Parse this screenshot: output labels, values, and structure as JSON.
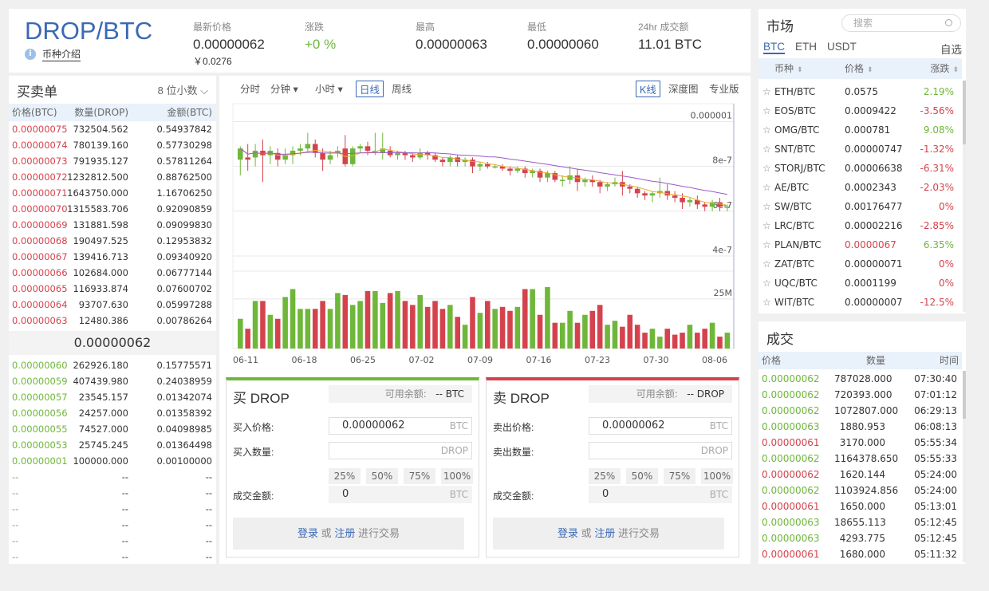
{
  "header": {
    "pair": "DROP/BTC",
    "intro": "币种介绍",
    "stats": [
      {
        "label": "最新价格",
        "value": "0.00000062",
        "sub": "￥0.0276"
      },
      {
        "label": "涨跌",
        "value": "+0 %"
      },
      {
        "label": "最高",
        "value": "0.00000063"
      },
      {
        "label": "最低",
        "value": "0.00000060"
      },
      {
        "label": "24hr 成交额",
        "value": "11.01 BTC"
      }
    ]
  },
  "orderbook": {
    "title": "买卖单",
    "precision": "8 位小数",
    "headers": [
      "价格(BTC)",
      "数量(DROP)",
      "金额(BTC)"
    ],
    "asks": [
      [
        "0.00000075",
        "732504.562",
        "0.54937842"
      ],
      [
        "0.00000074",
        "780139.160",
        "0.57730298"
      ],
      [
        "0.00000073",
        "791935.127",
        "0.57811264"
      ],
      [
        "0.00000072",
        "1232812.500",
        "0.88762500"
      ],
      [
        "0.00000071",
        "1643750.000",
        "1.16706250"
      ],
      [
        "0.00000070",
        "1315583.706",
        "0.92090859"
      ],
      [
        "0.00000069",
        "131881.598",
        "0.09099830"
      ],
      [
        "0.00000068",
        "190497.525",
        "0.12953832"
      ],
      [
        "0.00000067",
        "139416.713",
        "0.09340920"
      ],
      [
        "0.00000066",
        "102684.000",
        "0.06777144"
      ],
      [
        "0.00000065",
        "116933.874",
        "0.07600702"
      ],
      [
        "0.00000064",
        "93707.630",
        "0.05997288"
      ],
      [
        "0.00000063",
        "12480.386",
        "0.00786264"
      ]
    ],
    "last": "0.00000062",
    "bids": [
      [
        "0.00000060",
        "262926.180",
        "0.15775571"
      ],
      [
        "0.00000059",
        "407439.980",
        "0.24038959"
      ],
      [
        "0.00000057",
        "23545.157",
        "0.01342074"
      ],
      [
        "0.00000056",
        "24257.000",
        "0.01358392"
      ],
      [
        "0.00000055",
        "74527.000",
        "0.04098985"
      ],
      [
        "0.00000053",
        "25745.245",
        "0.01364498"
      ],
      [
        "0.00000001",
        "100000.000",
        "0.00100000"
      ],
      [
        "--",
        "--",
        "--"
      ],
      [
        "--",
        "--",
        "--"
      ],
      [
        "--",
        "--",
        "--"
      ],
      [
        "--",
        "--",
        "--"
      ],
      [
        "--",
        "--",
        "--"
      ],
      [
        "--",
        "--",
        "--"
      ]
    ]
  },
  "chart": {
    "intervals": [
      "分时",
      "分钟",
      "小时",
      "日线",
      "周线"
    ],
    "active": "日线",
    "views": [
      "K线",
      "深度图",
      "专业版"
    ],
    "active_view": "K线",
    "price_ticks": [
      "0.000001",
      "8e-7",
      "6e-7",
      "4e-7"
    ],
    "vol_tick": "25M",
    "dates": [
      "06-11",
      "06-18",
      "06-25",
      "07-02",
      "07-09",
      "07-16",
      "07-23",
      "07-30",
      "08-06"
    ]
  },
  "chart_data": {
    "type": "candlestick",
    "x": [
      "06-11",
      "06-18",
      "06-25",
      "07-02",
      "07-09",
      "07-16",
      "07-23",
      "07-30",
      "08-06"
    ],
    "y_ticks": [
      "0.000001",
      "8e-7",
      "6e-7",
      "4e-7"
    ],
    "candles": [
      [
        8.3,
        8.8,
        8.1,
        8.9,
        7.6
      ],
      [
        8.4,
        8.3,
        8.2,
        9.0,
        7.8
      ],
      [
        8.4,
        8.7,
        8.3,
        9.0,
        8.0
      ],
      [
        8.7,
        8.5,
        8.4,
        9.2,
        7.3
      ],
      [
        8.5,
        8.7,
        8.3,
        8.9,
        8.1
      ],
      [
        8.6,
        8.3,
        8.2,
        8.8,
        8.0
      ],
      [
        8.3,
        8.5,
        8.2,
        8.8,
        8.1
      ],
      [
        8.5,
        8.7,
        8.3,
        8.9,
        8.1
      ],
      [
        8.7,
        8.8,
        8.6,
        9.0,
        8.5
      ],
      [
        8.8,
        9.0,
        8.6,
        9.5,
        8.6
      ],
      [
        9.0,
        8.6,
        8.4,
        9.2,
        8.4
      ],
      [
        8.6,
        8.3,
        8.2,
        8.8,
        7.8
      ],
      [
        8.3,
        8.5,
        8.2,
        8.7,
        8.1
      ],
      [
        8.6,
        8.7,
        8.5,
        8.9,
        8.4
      ],
      [
        8.8,
        8.1,
        8.0,
        9.4,
        8.0
      ],
      [
        8.1,
        8.8,
        8.0,
        8.9,
        8.0
      ],
      [
        8.8,
        8.9,
        8.7,
        9.0,
        8.6
      ],
      [
        8.9,
        8.7,
        8.6,
        9.1,
        8.5
      ],
      [
        8.7,
        8.7,
        8.6,
        9.5,
        8.5
      ],
      [
        8.6,
        8.8,
        8.5,
        9.5,
        8.3
      ],
      [
        8.7,
        8.5,
        8.4,
        8.9,
        8.4
      ],
      [
        8.5,
        8.6,
        8.4,
        8.7,
        8.3
      ],
      [
        8.6,
        8.5,
        8.4,
        8.7,
        8.3
      ],
      [
        8.5,
        8.4,
        8.3,
        8.6,
        8.2
      ],
      [
        8.4,
        8.6,
        8.3,
        8.8,
        8.3
      ],
      [
        8.6,
        8.5,
        8.4,
        8.7,
        8.3
      ],
      [
        8.5,
        8.3,
        8.2,
        8.6,
        8.2
      ],
      [
        8.3,
        8.2,
        8.1,
        8.4,
        8.0
      ],
      [
        8.2,
        8.4,
        8.1,
        8.5,
        8.0
      ],
      [
        8.4,
        8.2,
        8.1,
        8.5,
        8.0
      ],
      [
        8.2,
        8.3,
        8.1,
        8.4,
        8.0
      ],
      [
        8.3,
        8.0,
        7.9,
        8.4,
        7.7
      ],
      [
        8.0,
        8.1,
        7.9,
        8.2,
        7.8
      ],
      [
        8.1,
        8.0,
        7.9,
        8.2,
        7.9
      ],
      [
        8.0,
        8.0,
        7.9,
        8.1,
        7.9
      ],
      [
        8.0,
        7.9,
        7.8,
        8.1,
        7.8
      ],
      [
        7.9,
        7.8,
        7.7,
        8.0,
        7.6
      ],
      [
        7.8,
        7.9,
        7.7,
        8.0,
        7.7
      ],
      [
        7.9,
        7.7,
        7.6,
        8.0,
        7.5
      ],
      [
        7.7,
        7.8,
        7.6,
        7.9,
        7.5
      ],
      [
        7.8,
        7.5,
        7.4,
        7.9,
        7.3
      ],
      [
        7.5,
        7.7,
        7.4,
        7.8,
        7.3
      ],
      [
        7.7,
        7.4,
        7.3,
        7.8,
        7.3
      ],
      [
        7.4,
        7.4,
        7.3,
        7.6,
        7.1
      ],
      [
        7.4,
        7.6,
        7.3,
        8.0,
        7.2
      ],
      [
        7.6,
        7.3,
        7.2,
        7.9,
        6.9
      ],
      [
        7.3,
        7.4,
        7.2,
        7.5,
        7.1
      ],
      [
        7.4,
        7.3,
        7.2,
        7.6,
        7.1
      ],
      [
        7.3,
        7.1,
        7.0,
        7.4,
        6.8
      ],
      [
        7.1,
        7.2,
        7.0,
        7.3,
        6.9
      ],
      [
        7.2,
        7.3,
        7.1,
        7.5,
        7.1
      ],
      [
        7.3,
        7.1,
        7.0,
        7.8,
        6.7
      ],
      [
        7.1,
        7.0,
        6.9,
        7.2,
        6.8
      ],
      [
        7.0,
        6.8,
        6.7,
        7.1,
        6.6
      ],
      [
        6.8,
        6.7,
        6.6,
        6.9,
        6.5
      ],
      [
        6.7,
        6.8,
        6.6,
        6.9,
        6.4
      ],
      [
        6.8,
        6.9,
        6.7,
        7.5,
        6.6
      ],
      [
        6.9,
        6.7,
        6.6,
        7.2,
        6.5
      ],
      [
        6.7,
        6.6,
        6.5,
        6.9,
        6.4
      ],
      [
        6.6,
        6.4,
        6.3,
        6.8,
        6.1
      ],
      [
        6.4,
        6.5,
        6.3,
        6.6,
        6.2
      ],
      [
        6.5,
        6.3,
        6.2,
        6.7,
        6.1
      ],
      [
        6.3,
        6.2,
        6.1,
        6.4,
        6.0
      ],
      [
        6.2,
        6.4,
        6.1,
        6.5,
        6.0
      ],
      [
        6.4,
        6.2,
        6.1,
        6.6,
        6.0
      ],
      [
        6.2,
        6.2,
        6.1,
        6.3,
        6.0
      ]
    ],
    "volumes": [
      15,
      10,
      24,
      24,
      17,
      15,
      26,
      30,
      20,
      20,
      20,
      24,
      20,
      28,
      27,
      22,
      24,
      29,
      29,
      23,
      28,
      29,
      24,
      22,
      27,
      21,
      24,
      20,
      22,
      16,
      12,
      26,
      18,
      24,
      20,
      21,
      19,
      21,
      30,
      30,
      17,
      31,
      13,
      13,
      19,
      13,
      17,
      19,
      22,
      12,
      14,
      11,
      17,
      12,
      8,
      10,
      6,
      10,
      7,
      8,
      12,
      8,
      10,
      13,
      6,
      8
    ]
  },
  "trade": {
    "buy": {
      "title": "买 DROP",
      "avail_label": "可用余额:",
      "avail_value": "-- BTC",
      "price_label": "买入价格:",
      "price": "0.00000062",
      "price_unit": "BTC",
      "qty_label": "买入数量:",
      "qty_unit": "DROP",
      "total_label": "成交金额:",
      "total": "0",
      "total_unit": "BTC"
    },
    "sell": {
      "title": "卖 DROP",
      "avail_label": "可用余额:",
      "avail_value": "-- DROP",
      "price_label": "卖出价格:",
      "price": "0.00000062",
      "price_unit": "BTC",
      "qty_label": "卖出数量:",
      "qty_unit": "DROP",
      "total_label": "成交金额:",
      "total": "0",
      "total_unit": "BTC"
    },
    "pcts": [
      "25%",
      "50%",
      "75%",
      "100%"
    ],
    "login": "登录",
    "or": "或",
    "register": "注册",
    "trade_text": "进行交易"
  },
  "market": {
    "title": "市场",
    "search_placeholder": "搜索",
    "tabs": [
      "BTC",
      "ETH",
      "USDT"
    ],
    "fav": "自选",
    "headers": [
      "币种",
      "价格",
      "涨跌"
    ],
    "rows": [
      [
        "ETH/BTC",
        "0.0575",
        "2.19%",
        "up"
      ],
      [
        "EOS/BTC",
        "0.0009422",
        "-3.56%",
        "down"
      ],
      [
        "OMG/BTC",
        "0.000781",
        "9.08%",
        "up"
      ],
      [
        "SNT/BTC",
        "0.00000747",
        "-1.32%",
        "down"
      ],
      [
        "STORJ/BTC",
        "0.00006638",
        "-6.31%",
        "down"
      ],
      [
        "AE/BTC",
        "0.0002343",
        "-2.03%",
        "down"
      ],
      [
        "SW/BTC",
        "0.00176477",
        "0%",
        "down"
      ],
      [
        "LRC/BTC",
        "0.00002216",
        "-2.85%",
        "down"
      ],
      [
        "PLAN/BTC",
        "0.0000067",
        "6.35%",
        "up"
      ],
      [
        "ZAT/BTC",
        "0.00000071",
        "0%",
        "down"
      ],
      [
        "UQC/BTC",
        "0.0001199",
        "0%",
        "down"
      ],
      [
        "WIT/BTC",
        "0.00000007",
        "-12.5%",
        "down"
      ]
    ]
  },
  "trades": {
    "title": "成交",
    "headers": [
      "价格",
      "数量",
      "时间"
    ],
    "rows": [
      [
        "0.00000062",
        "787028.000",
        "07:30:40",
        "up"
      ],
      [
        "0.00000062",
        "720393.000",
        "07:01:12",
        "up"
      ],
      [
        "0.00000062",
        "1072807.000",
        "06:29:13",
        "up"
      ],
      [
        "0.00000063",
        "1880.953",
        "06:08:13",
        "up"
      ],
      [
        "0.00000061",
        "3170.000",
        "05:55:34",
        "down"
      ],
      [
        "0.00000062",
        "1164378.650",
        "05:55:33",
        "up"
      ],
      [
        "0.00000062",
        "1620.144",
        "05:24:00",
        "down"
      ],
      [
        "0.00000062",
        "1103924.856",
        "05:24:00",
        "up"
      ],
      [
        "0.00000061",
        "1650.000",
        "05:13:01",
        "down"
      ],
      [
        "0.00000063",
        "18655.113",
        "05:12:45",
        "up"
      ],
      [
        "0.00000063",
        "4293.775",
        "05:12:45",
        "up"
      ],
      [
        "0.00000061",
        "1680.000",
        "05:11:32",
        "down"
      ]
    ]
  },
  "colors": {
    "up": "#6fb73a",
    "down": "#d4434d",
    "accent": "#3b68b5"
  }
}
